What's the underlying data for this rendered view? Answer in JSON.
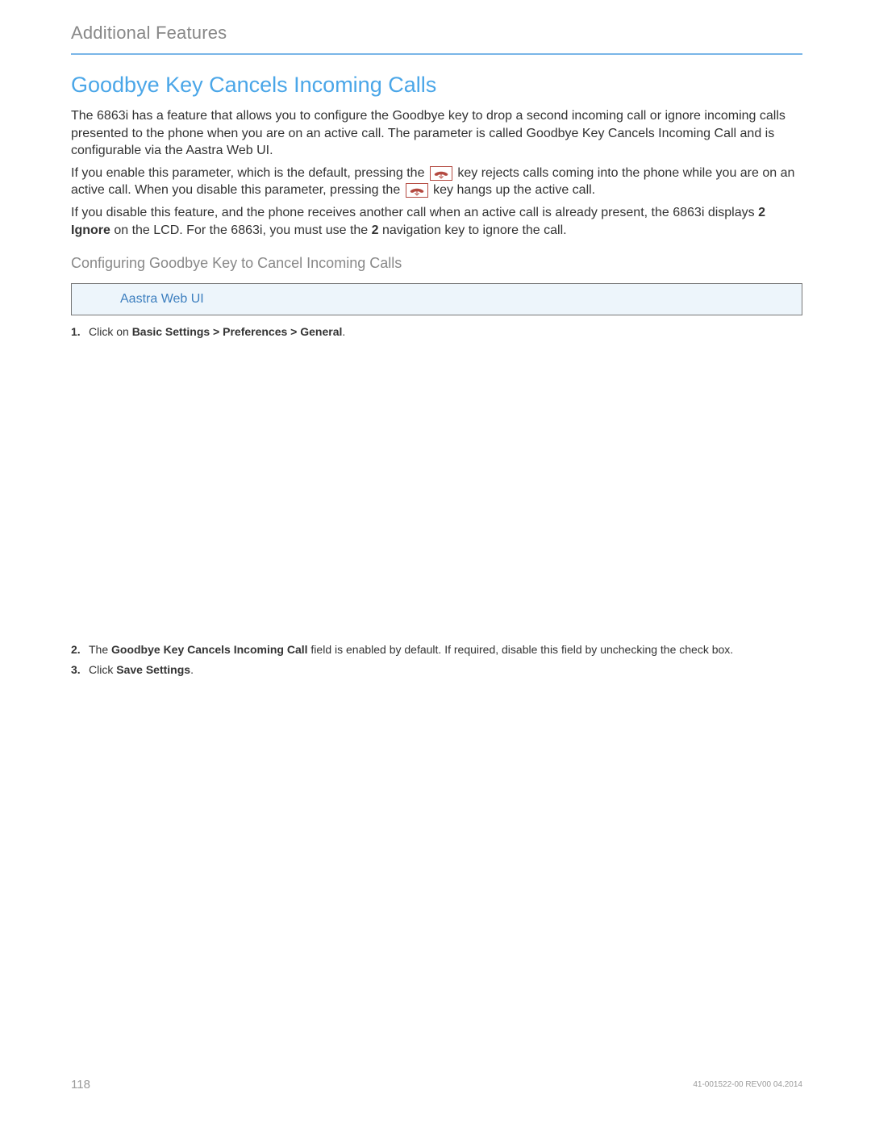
{
  "header": {
    "title": "Additional Features"
  },
  "section": {
    "title": "Goodbye Key Cancels Incoming Calls",
    "p1_a": "The 6863i has a feature that allows you to configure the",
    "p1_b": "Goodbye",
    "p1_c": " key to drop a second incoming call or ignore incoming calls presented to the phone when you are on an active call. The parameter is called Goodbye Key Cancels Incoming Call and is configurable via the Aastra Web UI.",
    "p2_a": "If you enable this parameter, which is the default, pressing the ",
    "p2_b": " key rejects calls coming into the phone while you are on an active call. When you disable this parameter, pressing the ",
    "p2_c": " key hangs up the active call.",
    "p3_a": "If you disable this feature, and the phone receives another call when an active call is already present, the 6863i displays ",
    "p3_b": "2 Ignore",
    "p3_c": " on the LCD. For the 6863i, you must use the ",
    "p3_d": "2",
    "p3_e": " navigation key to ignore the call."
  },
  "subsection": {
    "title": "Configuring Goodbye Key to Cancel Incoming Calls",
    "ui_label": "Aastra Web UI",
    "steps": [
      {
        "num": "1.",
        "pre": "Click on ",
        "bold": "Basic Settings > Preferences > General",
        "post": "."
      },
      {
        "num": "2.",
        "pre": "The ",
        "bold": "Goodbye Key Cancels Incoming Call",
        "post": " field is enabled by default. If required, disable this field by unchecking the check box."
      },
      {
        "num": "3.",
        "pre": "Click ",
        "bold": "Save Settings",
        "post": "."
      }
    ]
  },
  "footer": {
    "page": "118",
    "docrev": "41-001522-00 REV00 04.2014"
  },
  "icons": {
    "hangup": "hangup-key-icon"
  }
}
